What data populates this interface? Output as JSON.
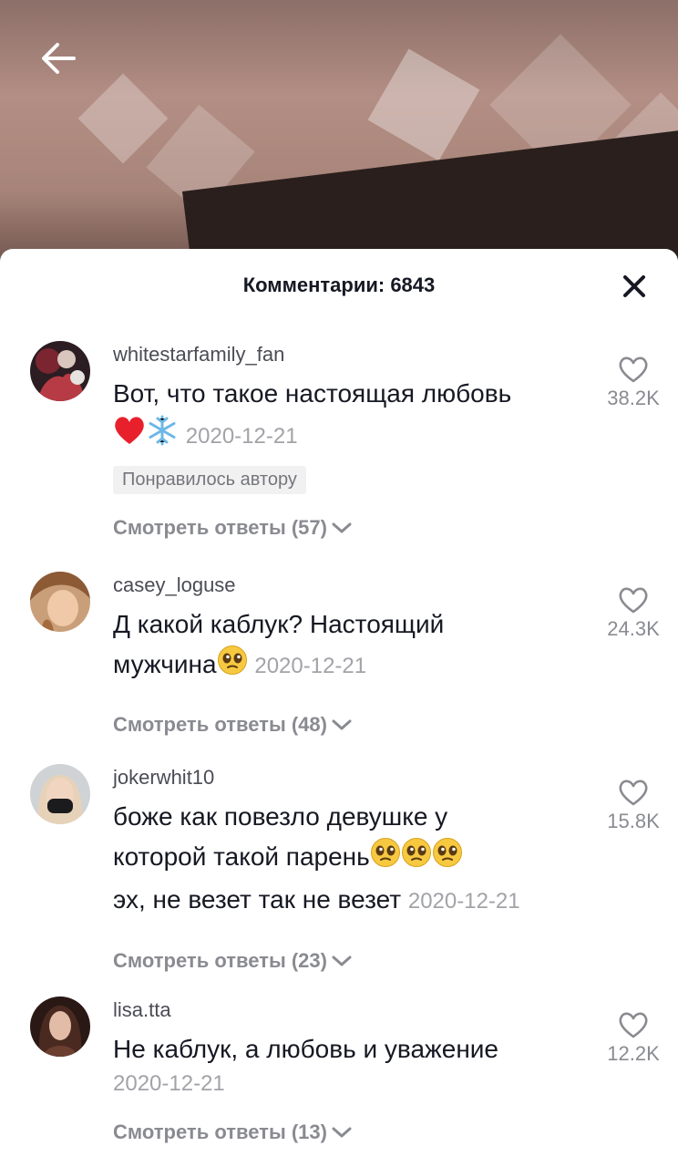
{
  "header": {
    "title": "Комментарии: 6843"
  },
  "comments": [
    {
      "username": "whitestarfamily_fan",
      "text_line1": "Вот, что такое настоящая любовь",
      "date": "2020-12-21",
      "badge": "Понравилось автору",
      "likes": "38.2K",
      "replies": "Смотреть ответы (57)",
      "emojis": [
        "red-heart",
        "snowflake"
      ]
    },
    {
      "username": "casey_loguse",
      "text_line1": "Д какой каблук? Настоящий",
      "text_line2": "мужчина",
      "date": "2020-12-21",
      "likes": "24.3K",
      "replies": "Смотреть ответы (48)",
      "emojis": [
        "pleading-face"
      ]
    },
    {
      "username": "jokerwhit10",
      "text_line1": "боже как повезло девушке у",
      "text_line2": "которой такой парень",
      "text_line3": "эх, не везет так не везет",
      "date": "2020-12-21",
      "likes": "15.8K",
      "replies": "Смотреть ответы (23)",
      "emojis": [
        "pleading-face",
        "pleading-face",
        "pleading-face"
      ]
    },
    {
      "username": "lisa.tta",
      "text_line1": "Не каблук, а любовь и уважение",
      "date": "2020-12-21",
      "likes": "12.2K",
      "replies": "Смотреть ответы (13)",
      "emojis": []
    }
  ],
  "icons": {
    "back": "back-arrow-icon",
    "close": "close-icon",
    "like": "heart-outline-icon",
    "expand": "chevron-down-icon"
  },
  "colors": {
    "text": "#161823",
    "secondary": "#8a8b91",
    "date": "#a2a3a8",
    "heart": "#e8202c"
  }
}
